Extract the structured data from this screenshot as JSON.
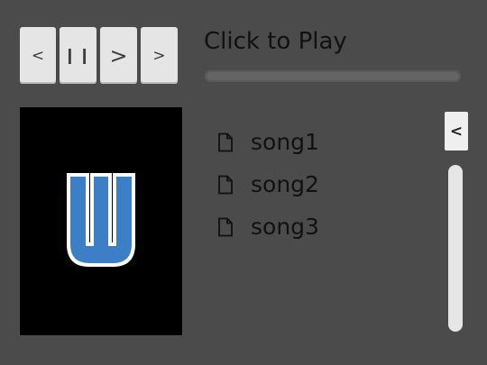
{
  "controls": {
    "prev_label": "<",
    "pause_label": "❙❙",
    "play_label": ">",
    "next_label": ">"
  },
  "now_playing": {
    "title": "Click to Play",
    "progress": 0
  },
  "album_art": {
    "icon": "w-logo-icon",
    "color": "#3d7fc6"
  },
  "playlist": {
    "collapse_label": "<",
    "songs": [
      {
        "label": "song1",
        "icon": "file-icon"
      },
      {
        "label": "song2",
        "icon": "file-icon"
      },
      {
        "label": "song3",
        "icon": "file-icon"
      }
    ]
  },
  "colors": {
    "background": "#4b4b4b",
    "button": "#e5e5e5",
    "logo_blue": "#3d7fc6"
  }
}
